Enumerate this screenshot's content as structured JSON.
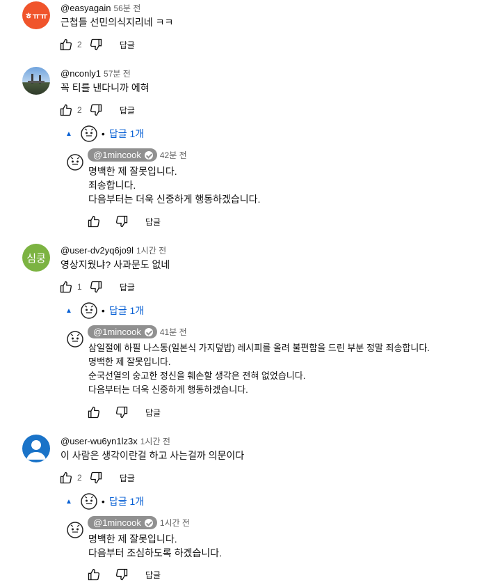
{
  "colors": {
    "link": "#065fd4",
    "muted": "#606060",
    "badge": "#909090"
  },
  "comments": [
    {
      "handle": "@easyagain",
      "time": "56분 전",
      "text": [
        "근첩들 선민의식지리네 ㅋㅋ"
      ],
      "likes": "2",
      "reply_label": "답글",
      "avatar": {
        "type": "text",
        "label": "ㅎㅠㅠ",
        "color": "#f0542b"
      }
    },
    {
      "handle": "@nconly1",
      "time": "57분 전",
      "text": [
        "꼭 티를 낸다니까 에혀"
      ],
      "likes": "2",
      "reply_label": "답글",
      "avatar": {
        "type": "photo",
        "color": "#4d86c6"
      },
      "replies_toggle": "답글 1개",
      "reply": {
        "handle": "@1mincook",
        "time": "42분 전",
        "text": [
          "명백한 제 잘못입니다.",
          "죄송합니다.",
          "다음부터는 더욱 신중하게 행동하겠습니다."
        ],
        "likes": "",
        "reply_label": "답글"
      }
    },
    {
      "handle": "@user-dv2yq6jo9l",
      "time": "1시간 전",
      "text": [
        "영상지웠냐? 사과문도 없네"
      ],
      "likes": "1",
      "reply_label": "답글",
      "avatar": {
        "type": "text",
        "label": "심쿵",
        "color": "#7cb342"
      },
      "replies_toggle": "답글 1개",
      "reply": {
        "handle": "@1mincook",
        "time": "41분 전",
        "text": [
          "삼일절에 하필 나스동(일본식 가지덮밥) 레시피를 올려 불편함을 드린 부분 정말 죄송합니다.",
          "명백한 제 잘못입니다.",
          "순국선열의 숭고한 정신을 훼손할 생각은 전혀 없었습니다.",
          "다음부터는 더욱 신중하게 행동하겠습니다."
        ],
        "likes": "",
        "reply_label": "답글"
      }
    },
    {
      "handle": "@user-wu6yn1lz3x",
      "time": "1시간 전",
      "text": [
        "이 사람은 생각이란걸 하고 사는걸까 의문이다"
      ],
      "likes": "2",
      "reply_label": "답글",
      "avatar": {
        "type": "person",
        "color": "#1a73c8"
      },
      "replies_toggle": "답글 1개",
      "reply": {
        "handle": "@1mincook",
        "time": "1시간 전",
        "text": [
          "명백한 제 잘못입니다.",
          "다음부터 조심하도록 하겠습니다."
        ],
        "likes": "",
        "reply_label": "답글"
      }
    }
  ]
}
